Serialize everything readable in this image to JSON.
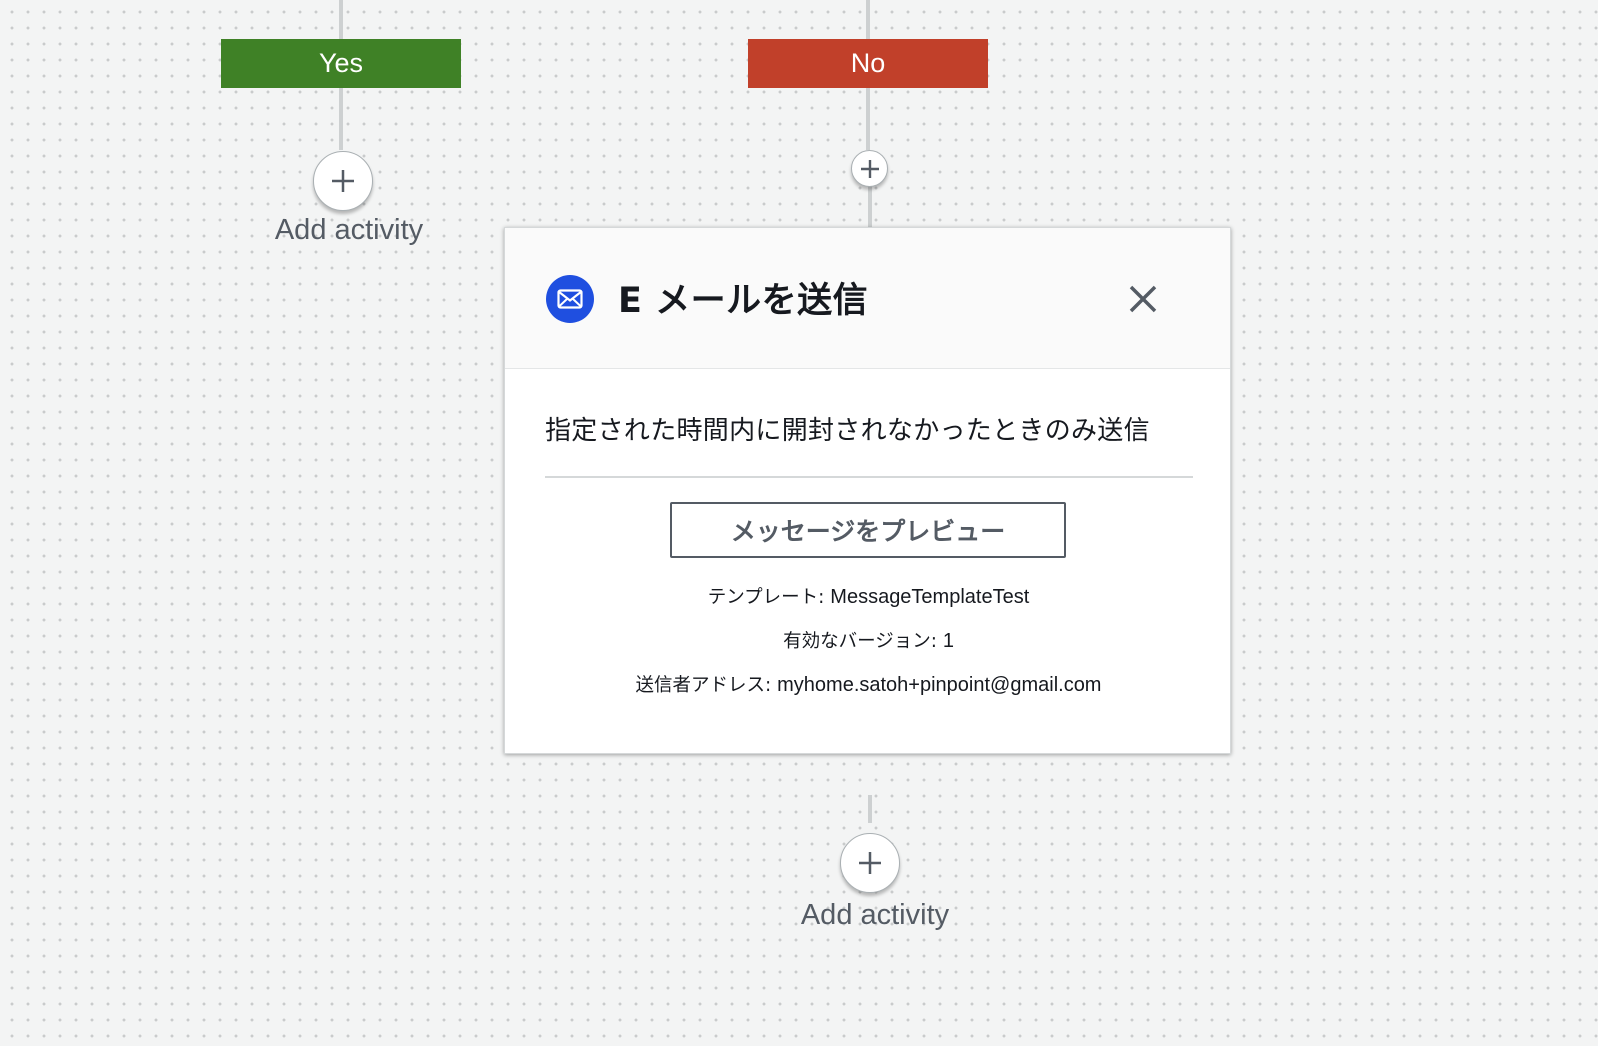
{
  "branches": {
    "yes_label": "Yes",
    "no_label": "No"
  },
  "yes_branch": {
    "add_activity_label": "Add activity"
  },
  "bottom": {
    "add_activity_label": "Add activity"
  },
  "email_card": {
    "title": "E メールを送信",
    "icon": "mail-icon",
    "close_icon": "close-icon",
    "condition_text": "指定された時間内に開封されなかったときのみ送信",
    "preview_button_label": "メッセージをプレビュー",
    "template_label": "テンプレート: ",
    "template_value": "MessageTemplateTest",
    "version_label": "有効なバージョン: ",
    "version_value": "1",
    "sender_label": "送信者アドレス: ",
    "sender_value": "myhome.satoh+pinpoint@gmail.com"
  },
  "colors": {
    "yes": "#3f8126",
    "no": "#c1402a",
    "icon_blue": "#1f4fe0"
  }
}
